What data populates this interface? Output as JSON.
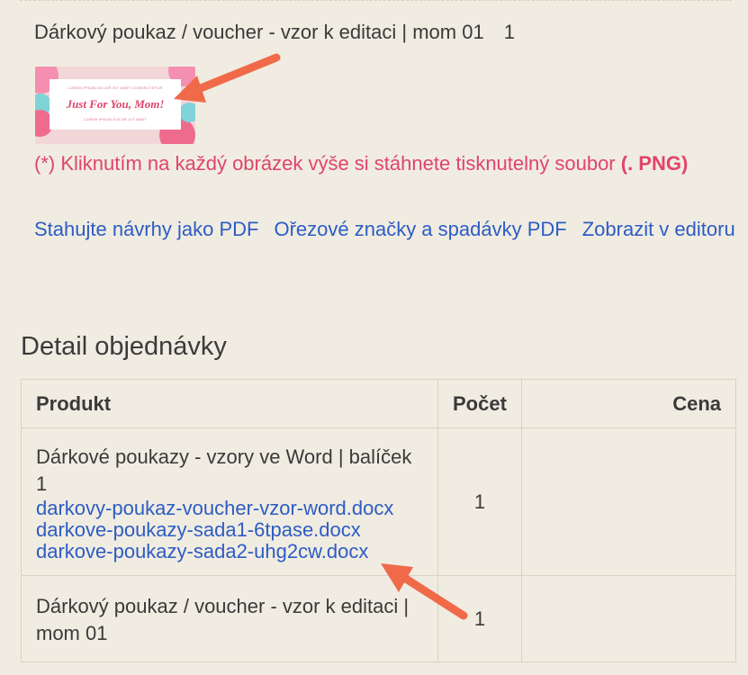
{
  "order_item": {
    "title": "Dárkový poukaz / voucher - vzor k editaci | mom 01",
    "qty": "1"
  },
  "thumbnail": {
    "top_line": "Lorem ipsum dolor sit amet consectetur",
    "heading": "Just For You, Mom!",
    "bottom_line": "Lorem ipsum dolor sit amet"
  },
  "note": {
    "text": "(*) Kliknutím na každý obrázek výše si stáhnete tisknutelný soubor ",
    "format": "(. PNG)"
  },
  "links": {
    "pdf": "Stahujte návrhy jako PDF",
    "crop_marks": "Ořezové značky a spadávky PDF",
    "editor": "Zobrazit v editoru"
  },
  "order_detail": {
    "title": "Detail objednávky",
    "columns": {
      "product": "Produkt",
      "qty": "Počet",
      "price": "Cena"
    },
    "rows": [
      {
        "product": "Dárkové poukazy - vzory ve Word | balíček 1",
        "files": [
          "darkovy-poukaz-voucher-vzor-word.docx",
          "darkove-poukazy-sada1-6tpase.docx",
          "darkove-poukazy-sada2-uhg2cw.docx"
        ],
        "qty": "1",
        "price": ""
      },
      {
        "product": "Dárkový poukaz / voucher - vzor k editaci | mom 01",
        "qty": "1",
        "price": ""
      }
    ]
  },
  "colors": {
    "background": "#f0ece1",
    "link": "#2d5cc4",
    "note": "#e0446c",
    "arrow": "#f06a4a"
  }
}
